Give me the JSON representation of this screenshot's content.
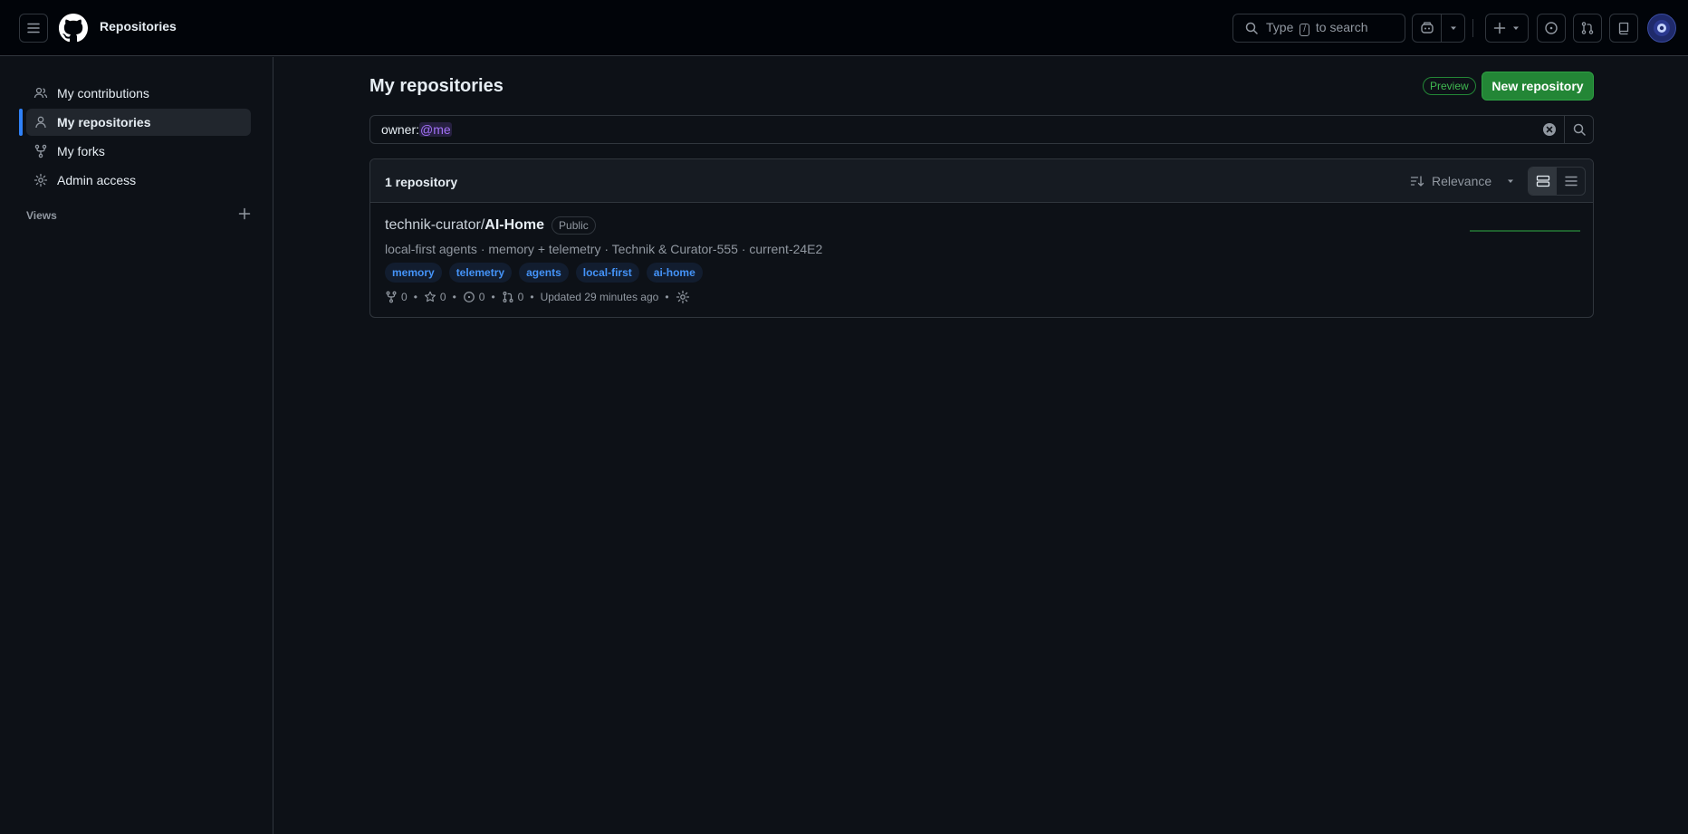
{
  "header": {
    "title": "Repositories",
    "search_prefix": "Type",
    "search_kbd": "/",
    "search_suffix": "to search"
  },
  "sidebar": {
    "items": [
      {
        "label": "My contributions",
        "icon": "people-icon"
      },
      {
        "label": "My repositories",
        "icon": "person-icon",
        "active": true
      },
      {
        "label": "My forks",
        "icon": "fork-icon"
      },
      {
        "label": "Admin access",
        "icon": "gear-icon"
      }
    ],
    "views_label": "Views"
  },
  "main": {
    "title": "My repositories",
    "preview_badge": "Preview",
    "new_repo_label": "New repository",
    "filter": {
      "keyword": "owner:",
      "token": "@me"
    },
    "results_count": "1 repository",
    "sort_label": "Relevance",
    "repos": [
      {
        "owner": "technik-curator/",
        "name": "AI-Home",
        "visibility": "Public",
        "description": "local-first agents · memory + telemetry · Technik & Curator-555 · current-24E2",
        "topics": [
          "memory",
          "telemetry",
          "agents",
          "local-first",
          "ai-home"
        ],
        "forks": "0",
        "stars": "0",
        "issues": "0",
        "pulls": "0",
        "updated": "Updated 29 minutes ago"
      }
    ]
  },
  "colors": {
    "background": "#0d1117",
    "header_bg": "#010409",
    "accent_green": "#238636",
    "link_blue": "#4493f8",
    "active_indicator": "#2f81f7"
  }
}
